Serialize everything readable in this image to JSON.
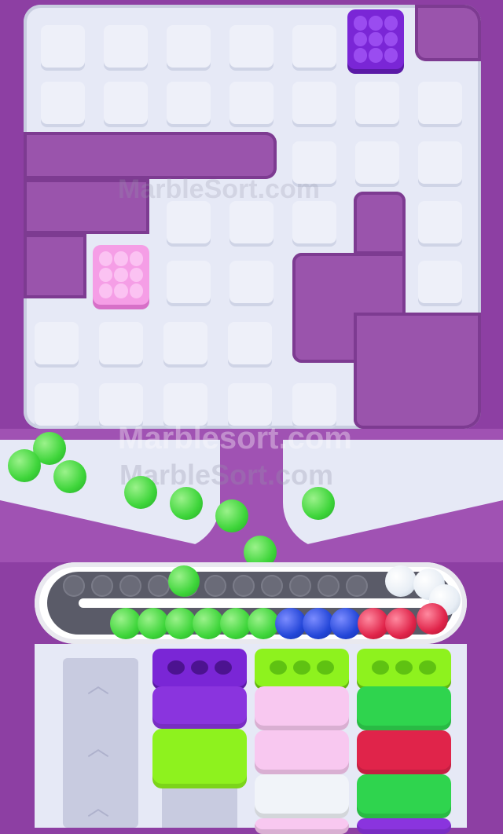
{
  "game": {
    "watermark_main": "Marblesort.com",
    "watermark_faint": "MarbleSort.com",
    "watermark_top": "MarbleSort.com"
  },
  "colors": {
    "background": "#8d3fa3",
    "board": "#e6e9f6",
    "purple": "#7a26d6",
    "pink": "#f59ee6",
    "green": "#2fd44e",
    "lime": "#8ef21e",
    "blue": "#2346d8",
    "red": "#e0244a",
    "white": "#f1f4f9",
    "lavender": "#f8c8f0"
  },
  "board": {
    "blocks": [
      {
        "name": "purple-block",
        "color": "purple"
      },
      {
        "name": "pink-block",
        "color": "pink"
      }
    ]
  },
  "conveyor": {
    "marbles_lower_row": [
      "green",
      "green",
      "green",
      "green",
      "green",
      "green",
      "blue",
      "blue",
      "blue",
      "red",
      "red",
      "red"
    ],
    "marbles_upper_row": [
      "green",
      "white",
      "white",
      "white"
    ]
  },
  "stacks": [
    {
      "name": "stack-purple-lime",
      "cap": "purple",
      "bricks": [
        "purple",
        "lime"
      ]
    },
    {
      "name": "stack-lime-pink",
      "cap": "lime",
      "bricks": [
        "pink",
        "pink",
        "white",
        "lavender"
      ]
    },
    {
      "name": "stack-lime-green",
      "cap": "lime",
      "bricks": [
        "green",
        "red",
        "green",
        "purple"
      ]
    }
  ]
}
